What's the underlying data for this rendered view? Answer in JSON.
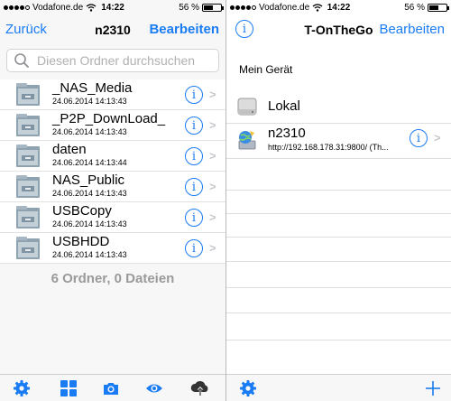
{
  "left": {
    "status": {
      "carrier": "Vodafone.de",
      "time": "14:22",
      "battery": "56 %",
      "battery_level": 0.56
    },
    "nav": {
      "back_label": "Zurück",
      "title": "n2310",
      "edit_label": "Bearbeiten"
    },
    "search": {
      "placeholder": "Diesen Ordner durchsuchen"
    },
    "folders": [
      {
        "name": "_NAS_Media",
        "date": "24.06.2014 14:13:43"
      },
      {
        "name": "_P2P_DownLoad_",
        "date": "24.06.2014 14:13:43"
      },
      {
        "name": "daten",
        "date": "24.06.2014 14:13:44"
      },
      {
        "name": "NAS_Public",
        "date": "24.06.2014 14:13:43"
      },
      {
        "name": "USBCopy",
        "date": "24.06.2014 14:13:43"
      },
      {
        "name": "USBHDD",
        "date": "24.06.2014 14:13:43"
      }
    ],
    "summary": "6 Ordner, 0 Dateien",
    "toolbar": [
      "gear-icon",
      "grid-icon",
      "camera-icon",
      "eye-icon",
      "cloud-upload-icon"
    ]
  },
  "right": {
    "status": {
      "carrier": "Vodafone.de",
      "time": "14:22",
      "battery": "56 %",
      "battery_level": 0.56
    },
    "nav": {
      "title": "T-OnTheGo",
      "edit_label": "Bearbeiten"
    },
    "section_header": "Mein Gerät",
    "devices": [
      {
        "name": "Lokal"
      },
      {
        "name": "n2310",
        "url": "http://192.168.178.31:9800/ (Th..."
      }
    ],
    "toolbar": [
      "gear-icon",
      "plus-icon"
    ]
  },
  "colors": {
    "accent": "#1a7cf4",
    "folder": "#8fa2b0",
    "chevron": "#c7c7cc"
  }
}
